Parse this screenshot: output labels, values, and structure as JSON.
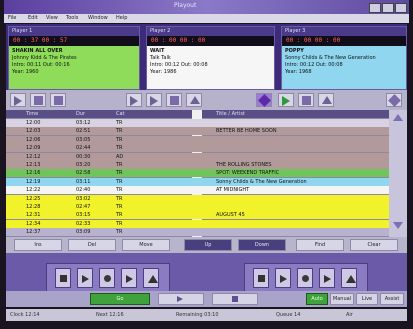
{
  "window": {
    "title": "Playout"
  },
  "menu": [
    "File",
    "Edit",
    "View",
    "Tools",
    "Window",
    "Help"
  ],
  "players": [
    {
      "header": "Player 1",
      "counter": "00 : 37   00 : 57",
      "color": "#8fdc5a",
      "lines": [
        "SHAKIN ALL OVER",
        "Johnny Kidd & The Pirates",
        "Intro: 00:11   Out: 00:16",
        "Year: 1960"
      ]
    },
    {
      "header": "Player 2",
      "counter": "00 : 00   00 : 00",
      "color": "#f6f6f6",
      "lines": [
        "WAIT",
        "Talk Talk",
        "Intro: 00:12   Out: 00:08",
        "Year: 1986"
      ]
    },
    {
      "header": "Player 3",
      "counter": "00 : 00   00 : 00",
      "color": "#8fd6ee",
      "lines": [
        "POPPY",
        "Sonny Childs & The New Generation",
        "Intro: 00:12   Out: 00:08",
        "Year: 1968"
      ]
    }
  ],
  "playlist": {
    "header": [
      "Time",
      "Dur",
      "Cat",
      "Title / Artist"
    ],
    "rows": [
      {
        "time": "12:00",
        "dur": "03:12",
        "cat": "TR",
        "text": "",
        "color": "#d8d2e2"
      },
      {
        "time": "12:03",
        "dur": "02:51",
        "cat": "TR",
        "text": "BETTER BE HOME SOON",
        "color": "#b39a9a"
      },
      {
        "time": "12:06",
        "dur": "03:05",
        "cat": "TR",
        "text": "",
        "color": "#b39a9a"
      },
      {
        "time": "12:09",
        "dur": "02:44",
        "cat": "TR",
        "text": "",
        "color": "#b39a9a"
      },
      {
        "time": "12:12",
        "dur": "00:30",
        "cat": "AD",
        "text": "",
        "color": "#b39a9a"
      },
      {
        "time": "12:13",
        "dur": "03:20",
        "cat": "TR",
        "text": "THE ROLLING STONES",
        "color": "#b39a9a"
      },
      {
        "time": "12:16",
        "dur": "02:58",
        "cat": "TR",
        "text": "SPOT: WEEKEND TRAFFIC",
        "color": "#6fc45a"
      },
      {
        "time": "12:19",
        "dur": "03:11",
        "cat": "TR",
        "text": "Sonny Childs & The New Generation",
        "color": "#8fd6ee"
      },
      {
        "time": "12:22",
        "dur": "02:40",
        "cat": "TR",
        "text": "AT MIDNIGHT",
        "color": "#f4f4f4"
      },
      {
        "time": "12:25",
        "dur": "03:02",
        "cat": "TR",
        "text": "",
        "color": "#f2f22a"
      },
      {
        "time": "12:28",
        "dur": "02:47",
        "cat": "TR",
        "text": "",
        "color": "#f2f22a"
      },
      {
        "time": "12:31",
        "dur": "03:15",
        "cat": "TR",
        "text": "AUGUST 45",
        "color": "#f2f22a"
      },
      {
        "time": "12:34",
        "dur": "02:33",
        "cat": "TR",
        "text": "",
        "color": "#f2f22a"
      },
      {
        "time": "12:37",
        "dur": "03:09",
        "cat": "TR",
        "text": "",
        "color": "#b9b2ce"
      }
    ]
  },
  "playlist_buttons": [
    "Ins",
    "Del",
    "Move",
    "Up",
    "Down",
    "Find",
    "Clear"
  ],
  "bottom": {
    "go_label": "Go",
    "mode_buttons": [
      "Auto",
      "Manual",
      "Live",
      "Assist"
    ]
  },
  "status": [
    "Clock 12:14",
    "Next 12:16",
    "Remaining 03:10",
    "Queue 14",
    "Air"
  ]
}
